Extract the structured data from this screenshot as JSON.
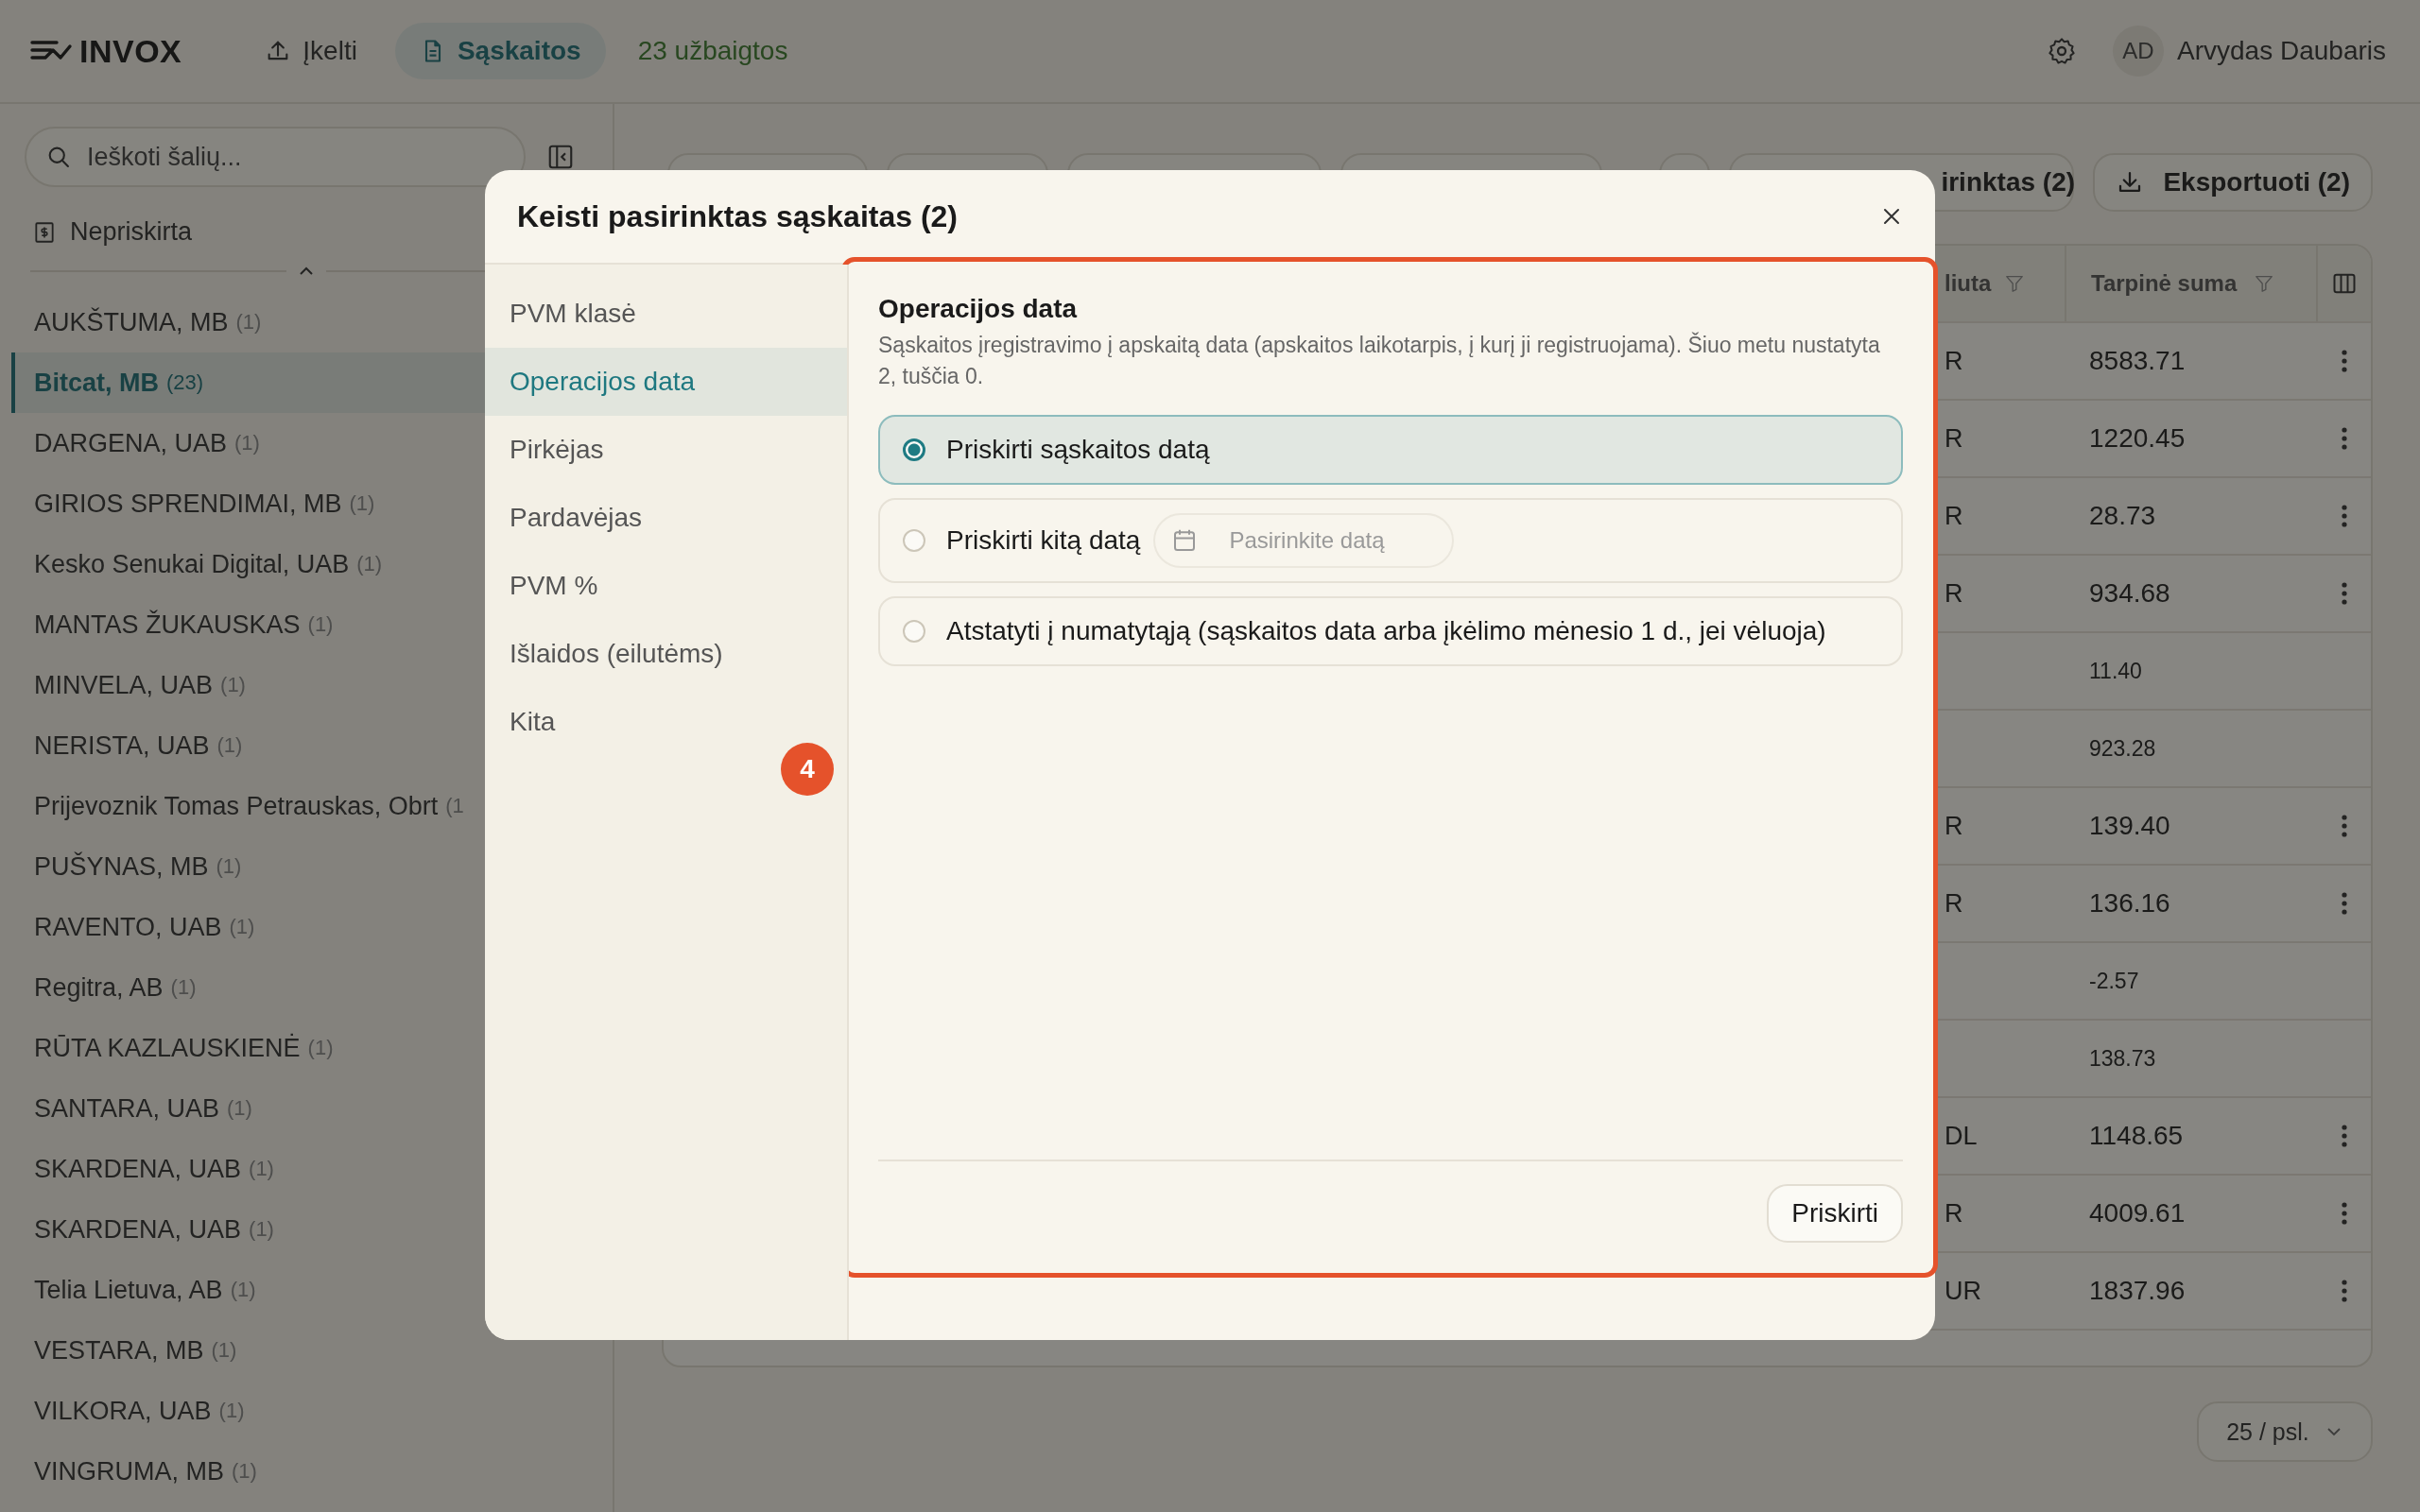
{
  "app": {
    "logo": "INVOX"
  },
  "nav": [
    {
      "label": "Įkelti",
      "selected": false
    },
    {
      "label": "Sąskaitos",
      "selected": true
    }
  ],
  "status": "23 užbaigtos",
  "user": {
    "initials": "AD",
    "name": "Arvydas Daubaris"
  },
  "sidebar": {
    "search": {
      "placeholder": "Ieškoti šalių..."
    },
    "unassigned": "Nepriskirta",
    "parties": [
      {
        "name": "AUKŠTUMA, MB",
        "count": "(1)",
        "selected": false
      },
      {
        "name": "Bitcat, MB",
        "count": "(23)",
        "selected": true
      },
      {
        "name": "DARGENA, UAB",
        "count": "(1)",
        "selected": false
      },
      {
        "name": "GIRIOS SPRENDIMAI, MB",
        "count": "(1)",
        "selected": false
      },
      {
        "name": "Kesko Senukai Digital, UAB",
        "count": "(1)",
        "selected": false
      },
      {
        "name": "MANTAS ŽUKAUSKAS",
        "count": "(1)",
        "selected": false
      },
      {
        "name": "MINVELA, UAB",
        "count": "(1)",
        "selected": false
      },
      {
        "name": "NERISTA, UAB",
        "count": "(1)",
        "selected": false
      },
      {
        "name": "Prijevoznik Tomas Petrauskas, Obrt",
        "count": "(1",
        "selected": false
      },
      {
        "name": "PUŠYNAS, MB",
        "count": "(1)",
        "selected": false
      },
      {
        "name": "RAVENTO, UAB",
        "count": "(1)",
        "selected": false
      },
      {
        "name": "Regitra, AB",
        "count": "(1)",
        "selected": false
      },
      {
        "name": "RŪTA KAZLAUSKIENĖ",
        "count": "(1)",
        "selected": false
      },
      {
        "name": "SANTARA, UAB",
        "count": "(1)",
        "selected": false
      },
      {
        "name": "SKARDENA, UAB",
        "count": "(1)",
        "selected": false
      },
      {
        "name": "SKARDENA, UAB",
        "count": "(1)",
        "selected": false
      },
      {
        "name": "Telia Lietuva, AB",
        "count": "(1)",
        "selected": false
      },
      {
        "name": "VESTARA, MB",
        "count": "(1)",
        "selected": false
      },
      {
        "name": "VILKORA, UAB",
        "count": "(1)",
        "selected": false
      },
      {
        "name": "VINGRUMA, MB",
        "count": "(1)",
        "selected": false
      }
    ]
  },
  "toolbar": {
    "assign_label": "irinktas (2)",
    "export_label": "Eksportuoti (2)"
  },
  "table": {
    "columns": [
      "liuta",
      "Tarpinė suma"
    ],
    "rows": [
      {
        "kind": "main",
        "currency": "R",
        "subtotal": "8583.71"
      },
      {
        "kind": "main",
        "currency": "R",
        "subtotal": "1220.45"
      },
      {
        "kind": "main",
        "currency": "R",
        "subtotal": "28.73"
      },
      {
        "kind": "main",
        "currency": "R",
        "subtotal": "934.68"
      },
      {
        "kind": "sub",
        "subtotal": "11.40"
      },
      {
        "kind": "sub",
        "subtotal": "923.28"
      },
      {
        "kind": "main",
        "currency": "R",
        "subtotal": "139.40"
      },
      {
        "kind": "main",
        "currency": "R",
        "subtotal": "136.16"
      },
      {
        "kind": "sub",
        "subtotal": "-2.57"
      },
      {
        "kind": "sub",
        "subtotal": "138.73"
      },
      {
        "kind": "main",
        "currency": "DL",
        "subtotal": "1148.65"
      },
      {
        "kind": "main",
        "currency": "R",
        "subtotal": "4009.61"
      },
      {
        "kind": "main",
        "currency": "UR",
        "subtotal": "1837.96"
      }
    ]
  },
  "pagination": {
    "page_size": "25 / psl."
  },
  "modal": {
    "title": "Keisti pasirinktas sąskaitas (2)",
    "sections": [
      {
        "label": "PVM klasė",
        "selected": false
      },
      {
        "label": "Operacijos data",
        "selected": true
      },
      {
        "label": "Pirkėjas",
        "selected": false
      },
      {
        "label": "Pardavėjas",
        "selected": false
      },
      {
        "label": "PVM %",
        "selected": false
      },
      {
        "label": "Išlaidos (eilutėms)",
        "selected": false
      },
      {
        "label": "Kita",
        "selected": false
      }
    ],
    "heading": "Operacijos data",
    "description": "Sąskaitos įregistravimo į apskaitą data (apskaitos laikotarpis, į kurį ji registruojama). Šiuo metu nustatyta 2, tuščia 0.",
    "options": [
      {
        "kind": "plain",
        "label": "Priskirti sąskaitos datą",
        "selected": true
      },
      {
        "kind": "date",
        "label": "Priskirti kitą datą",
        "selected": false,
        "date": {
          "placeholder": "Pasirinkite datą"
        }
      },
      {
        "kind": "plain",
        "label": "Atstatyti į numatytąją (sąskaitos data arba įkėlimo mėnesio 1 d., jei vėluoja)",
        "selected": false
      }
    ],
    "apply_button": "Priskirti"
  },
  "annotation": {
    "number": "4"
  }
}
